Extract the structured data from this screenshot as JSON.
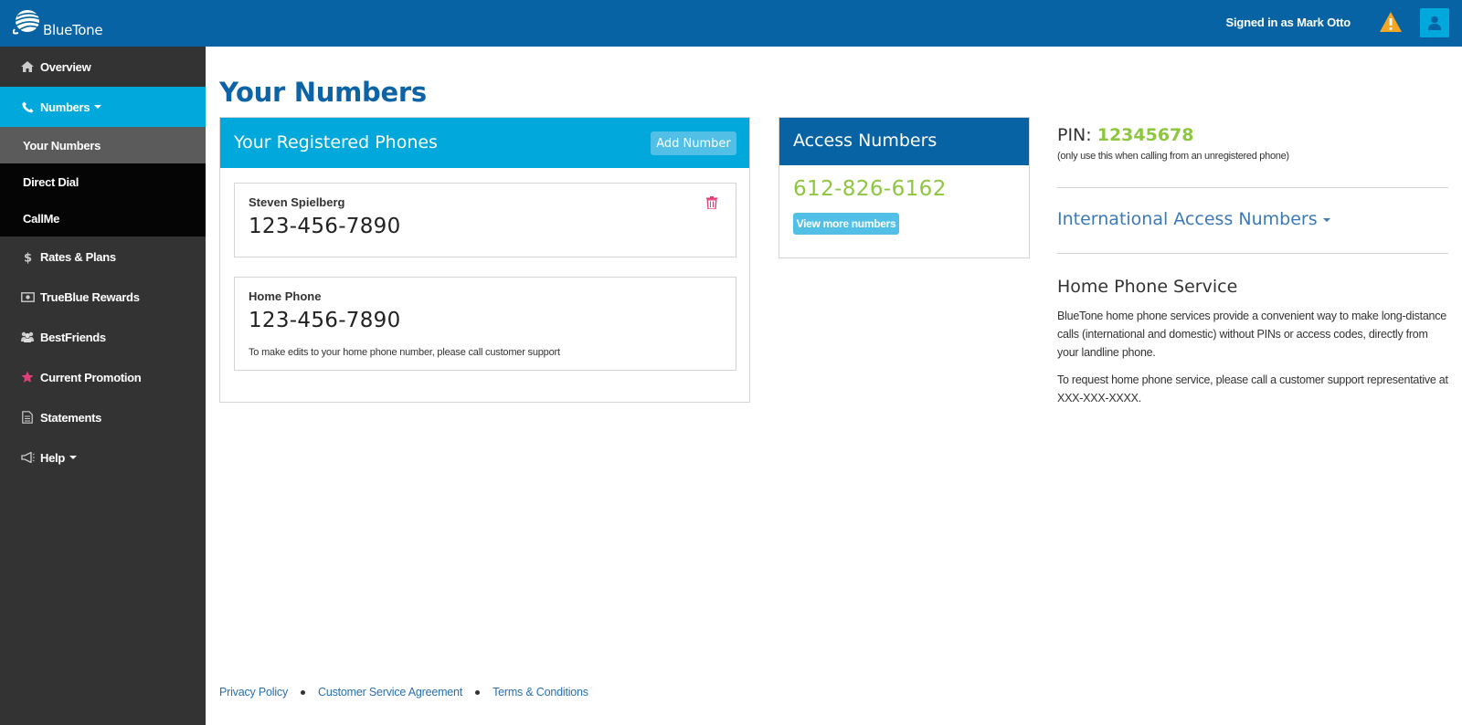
{
  "header": {
    "brand": "BlueTone",
    "signed_in": "Signed in as Mark Otto",
    "warning_icon": "warning-icon",
    "user_icon": "user-icon"
  },
  "sidebar": {
    "items": [
      {
        "label": "Overview",
        "icon": "home-icon"
      },
      {
        "label": "Numbers",
        "icon": "phone-icon"
      },
      {
        "label": "Rates & Plans",
        "icon": "dollar-icon"
      },
      {
        "label": "TrueBlue Rewards",
        "icon": "money-icon"
      },
      {
        "label": "BestFriends",
        "icon": "group-icon"
      },
      {
        "label": "Current Promotion",
        "icon": "star-icon"
      },
      {
        "label": "Statements",
        "icon": "document-icon"
      },
      {
        "label": "Help",
        "icon": "megaphone-icon"
      }
    ],
    "subitems": [
      {
        "label": "Your Numbers"
      },
      {
        "label": "Direct Dial"
      },
      {
        "label": "CallMe"
      }
    ]
  },
  "main": {
    "title": "Your Numbers",
    "registered": {
      "title": "Your Registered Phones",
      "add_label": "Add Number",
      "phones": [
        {
          "name": "Steven Spielberg",
          "number": "123-456-7890"
        },
        {
          "name": "Home Phone",
          "number": "123-456-7890",
          "note": "To make edits to your home phone number, please call customer support"
        }
      ]
    },
    "access": {
      "title": "Access Numbers",
      "number": "612-826-6162",
      "view_more_label": "View more numbers"
    },
    "pin": {
      "label": "PIN:",
      "value": "12345678",
      "note": "(only use this when calling from an unregistered phone)"
    },
    "international_label": "International Access Numbers",
    "home_service": {
      "title": "Home Phone Service",
      "paragraph1": "BlueTone home phone services provide a convenient way to make long-distance calls (international and domestic) without PINs or access codes, directly from your landline phone.",
      "paragraph2": "To request home phone service, please call a customer support representative at XXX-XXX-XXXX."
    }
  },
  "footer": {
    "links": [
      "Privacy Policy",
      "Customer Service Agreement",
      "Terms & Conditions"
    ]
  },
  "colors": {
    "topbar": "#0763a4",
    "accent": "#00a8db",
    "sidebar": "#333333",
    "green": "#8dc63f",
    "warning": "#f5a623",
    "danger": "#e0407a"
  }
}
